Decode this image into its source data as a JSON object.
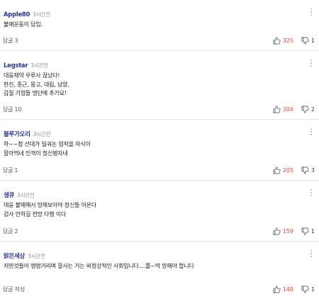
{
  "comments": [
    {
      "author": "Apple80",
      "time": "3시간전",
      "text": "불매운동이 답임.",
      "reply_label": "답글",
      "reply_count": "3",
      "likes": "325",
      "dislikes": "1"
    },
    {
      "author": "Legstar",
      "time": "3시간전",
      "text": "대웅제약  우루사  끊났다!\n한진,  종근,  몽고,  대림,  남양,\n갑질   기업들  명단에   추가요!",
      "reply_label": "답글",
      "reply_count": "10",
      "likes": "304",
      "dislikes": "2"
    },
    {
      "author": "블루가오리",
      "time": "3시간전",
      "text": "하~~참  선대가  일궈논   업적을 자식이\n말아먹네 인격이   정신병자네",
      "reply_label": "답글",
      "reply_count": "1",
      "likes": "205",
      "dislikes": "3"
    },
    {
      "author": "생큐",
      "time": "3시간전",
      "text": "대웅  불매해서  망해보아야   정신들 아온다\n검사  안하길  천망  다행  이다",
      "reply_label": "답글",
      "reply_count": "2",
      "likes": "159",
      "dislikes": "1"
    },
    {
      "author": "밝은세상",
      "time": "3시간전",
      "text": "저딴것들이  떵떵거리며   잘사는 거는  비정상적인  사회입니다....쫄~딱   망해야 합니다",
      "reply_label": "답글 작성",
      "reply_count": "",
      "likes": "148",
      "dislikes": "1"
    }
  ]
}
